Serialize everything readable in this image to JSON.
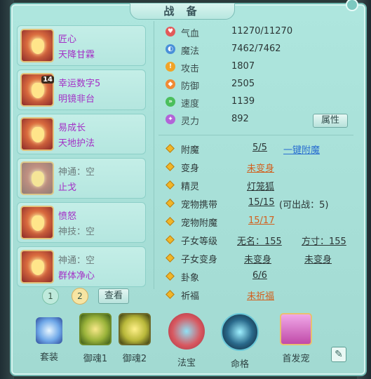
{
  "window": {
    "title": "战 备"
  },
  "slots": [
    {
      "line1": "匠心",
      "line2": "天降甘霖",
      "l1_style": "purple",
      "l2_style": "purple",
      "badge": ""
    },
    {
      "line1": "幸运数字5",
      "line2": "明镜非台",
      "l1_style": "purple",
      "l2_style": "purple",
      "badge": "14"
    },
    {
      "line1": "易成长",
      "line2": "天地护法",
      "l1_style": "purple",
      "l2_style": "purple",
      "badge": ""
    },
    {
      "line1": "神通：空",
      "line2": "止戈",
      "l1_style": "gray",
      "l2_style": "purple",
      "badge": ""
    },
    {
      "line1": "愤怒",
      "line2": "神技：空",
      "l1_style": "purple",
      "l2_style": "gray",
      "badge": ""
    },
    {
      "line1": "神通：空",
      "line2": "群体净心",
      "l1_style": "gray",
      "l2_style": "purple",
      "badge": ""
    }
  ],
  "pager": {
    "p1": "1",
    "p2": "2",
    "view_label": "查看"
  },
  "stats": [
    {
      "label": "气血",
      "value": "11270/11270",
      "icon_color": "#e25a5a",
      "icon": "heart-icon"
    },
    {
      "label": "魔法",
      "value": "7462/7462",
      "icon_color": "#4a90d9",
      "icon": "mana-icon"
    },
    {
      "label": "攻击",
      "value": "1807",
      "icon_color": "#f0a428",
      "icon": "attack-icon"
    },
    {
      "label": "防御",
      "value": "2505",
      "icon_color": "#f08a34",
      "icon": "shield-icon"
    },
    {
      "label": "速度",
      "value": "1139",
      "icon_color": "#4bbf5c",
      "icon": "speed-icon"
    },
    {
      "label": "灵力",
      "value": "892",
      "icon_color": "#b264d8",
      "icon": "spirit-icon"
    }
  ],
  "attr_button": "属性",
  "info": {
    "fumo": {
      "label": "附魔",
      "value": "5/5",
      "link": "一键附魔"
    },
    "bianshen": {
      "label": "变身",
      "value": "未变身"
    },
    "jingling": {
      "label": "精灵",
      "value": "灯笼狐"
    },
    "pet_carry": {
      "label": "宠物携带",
      "value": "15/15",
      "extra": "(可出战：5)"
    },
    "pet_fumo": {
      "label": "宠物附魔",
      "value": "15/17"
    },
    "child_level": {
      "label": "子女等级",
      "name1": "无名：155",
      "name2": "方寸：155"
    },
    "child_bianshen": {
      "label": "子女变身",
      "v1": "未变身",
      "v2": "未变身"
    },
    "guaxiang": {
      "label": "卦象",
      "value": "6/6"
    },
    "qifu": {
      "label": "祈福",
      "value": "未祈福"
    }
  },
  "bottom": [
    {
      "label": "套装",
      "icon": "suit-icon"
    },
    {
      "label": "御魂1",
      "icon": "soul1-icon"
    },
    {
      "label": "御魂2",
      "icon": "soul2-icon"
    },
    {
      "label": "法宝",
      "icon": "fabao-icon"
    },
    {
      "label": "命格",
      "icon": "mingge-icon"
    },
    {
      "label": "首发宠",
      "icon": "pet-icon"
    }
  ]
}
